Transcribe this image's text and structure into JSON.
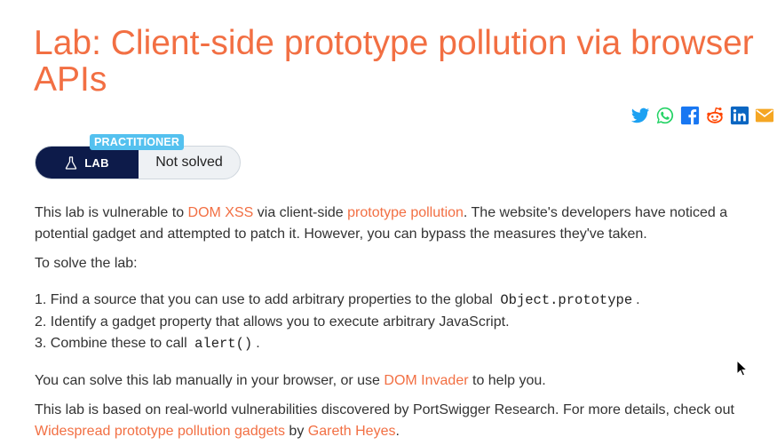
{
  "title": "Lab: Client-side prototype pollution via browser APIs",
  "share_icons": [
    "twitter-icon",
    "whatsapp-icon",
    "facebook-icon",
    "reddit-icon",
    "linkedin-icon",
    "email-icon"
  ],
  "status": {
    "level_badge": "PRACTITIONER",
    "lab_label": "LAB",
    "lab_icon": "flask-icon",
    "solved_text": "Not solved"
  },
  "intro": {
    "t1": "This lab is vulnerable to ",
    "link1": "DOM XSS",
    "t2": " via client-side ",
    "link2": "prototype pollution",
    "t3": ". The website's developers have noticed a potential gadget and attempted to patch it. However, you can bypass the measures they've taken."
  },
  "solve_heading": "To solve the lab:",
  "steps": [
    {
      "text": "1. Find a source that you can use to add arbitrary properties to the global ",
      "code": "Object.prototype",
      "after": "."
    },
    {
      "text": "2. Identify a gadget property that allows you to execute arbitrary JavaScript.",
      "code": "",
      "after": ""
    },
    {
      "text": "3. Combine these to call ",
      "code": "alert()",
      "after": "."
    }
  ],
  "manual": {
    "t1": "You can solve this lab manually in your browser, or use ",
    "link": "DOM Invader",
    "t2": " to help you."
  },
  "research": {
    "t1": "This lab is based on real-world vulnerabilities discovered by PortSwigger Research. For more details, check out ",
    "link1": "Widespread prototype pollution gadgets",
    "t2": " by ",
    "link2": "Gareth Heyes",
    "t3": "."
  },
  "colors": {
    "accent": "#f26f43",
    "lab_bg": "#0d1b4a",
    "badge_bg": "#54c1ef"
  }
}
